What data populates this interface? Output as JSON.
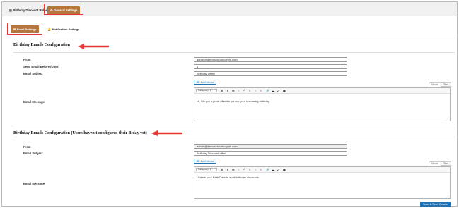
{
  "top_tabs": {
    "discount_rules": "Birthday Discount Rules",
    "general_settings": "General Settings"
  },
  "sub_tabs": {
    "email_settings": "Email Settings",
    "notification_settings": "Notification Settings"
  },
  "section1": {
    "title": "Birthday Emails Configuration",
    "from_label": "From",
    "from_value": "admin@demos.wcoekoppis.com",
    "send_before_label": "Send Email Before (Days)",
    "send_before_value": "1",
    "subject_label": "Email Subject",
    "subject_value": "Birthday Offer!",
    "message_label": "Email Message",
    "message_text": "Hi, We got a great offer for you on your upcoming birthday."
  },
  "section2": {
    "title": "Birthday Emails Configuration (Users haven't configured their B'day yet)",
    "from_label": "From",
    "from_value": "admin@demos.wcoekoppis.com",
    "subject_label": "Email Subject",
    "subject_value": "Birthday Discount offer!",
    "message_label": "Email Message",
    "message_text": "Update your Birth Date to avail birthday discounts."
  },
  "editor": {
    "add_media": "Add Media",
    "visual_tab": "Visual",
    "text_tab": "Text",
    "paragraph": "Paragraph"
  },
  "save_button": "Save & Send Emails",
  "colors": {
    "accent_brown": "#b5763e",
    "highlight_red": "#e53935",
    "primary_blue": "#2271b1"
  }
}
